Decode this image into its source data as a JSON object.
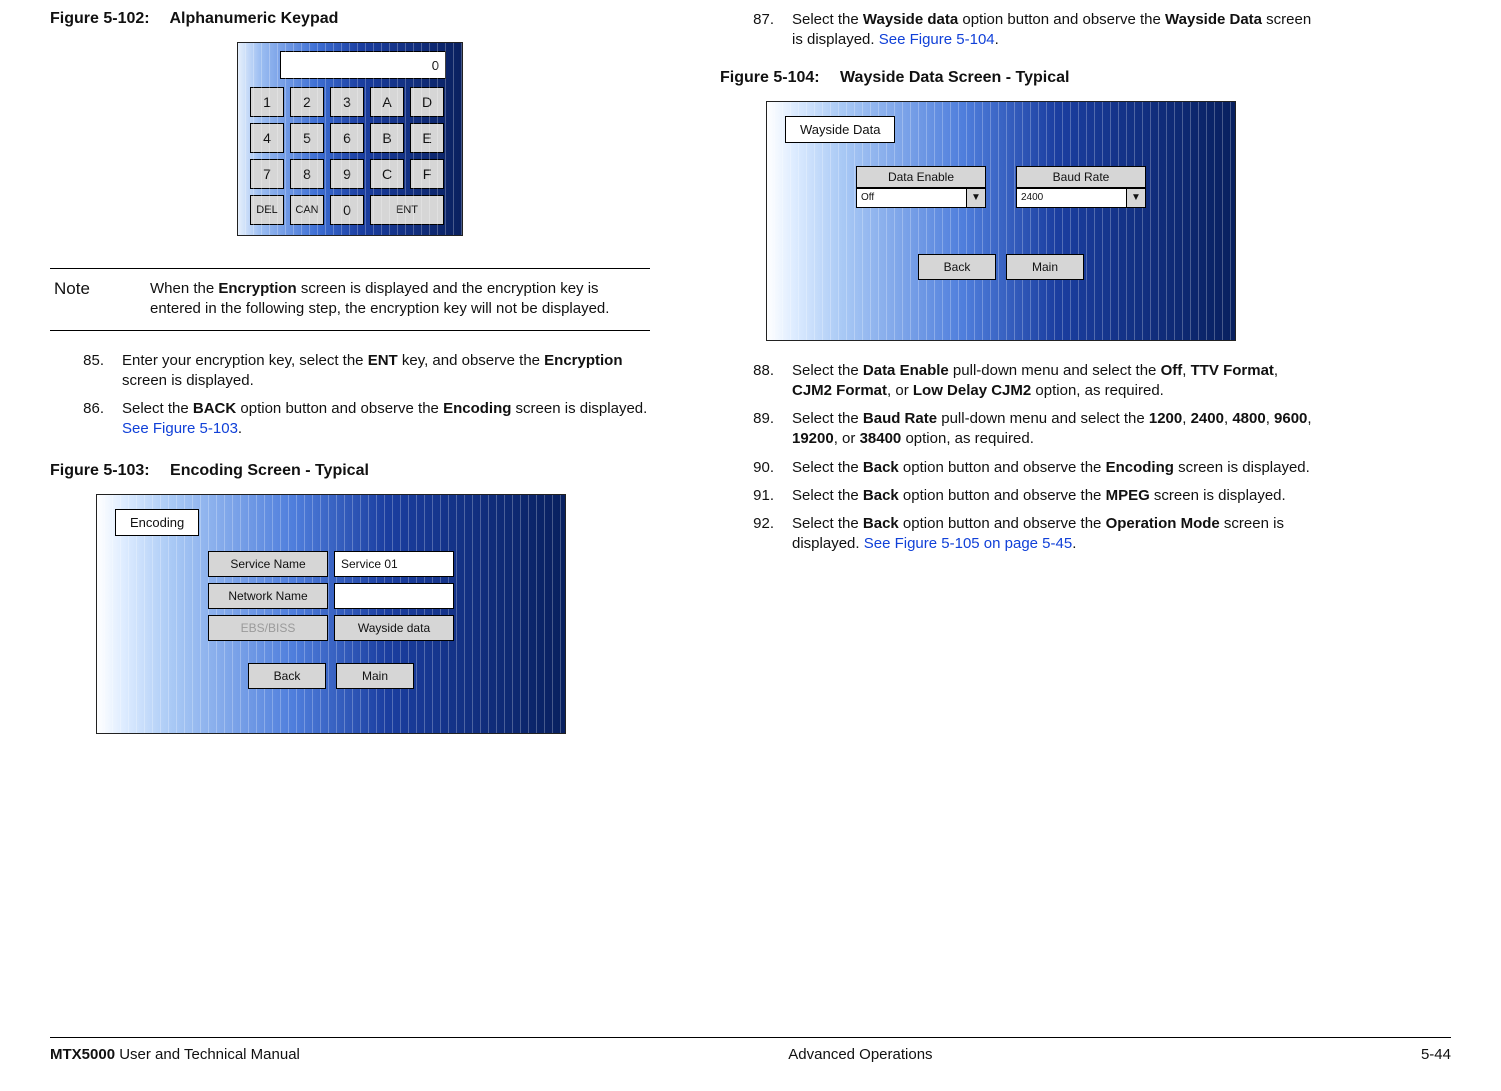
{
  "fig102": {
    "label": "Figure 5-102:",
    "title": "Alphanumeric Keypad"
  },
  "keypad": {
    "display": "0",
    "rows": [
      [
        "1",
        "2",
        "3",
        "A",
        "D"
      ],
      [
        "4",
        "5",
        "6",
        "B",
        "E"
      ],
      [
        "7",
        "8",
        "9",
        "C",
        "F"
      ]
    ],
    "bottom": {
      "del": "DEL",
      "can": "CAN",
      "zero": "0",
      "ent": "ENT"
    }
  },
  "note": {
    "label": "Note",
    "text_pre": "When the ",
    "bold1": "Encryption",
    "text_mid": " screen is displayed and the encryption key is entered in the following step, the encryption key will not be displayed."
  },
  "steps_left": {
    "s85": {
      "num": "85.",
      "pre": "Enter your encryption key, select the ",
      "b1": "ENT",
      "mid": " key, and observe the ",
      "b2": "Encryption",
      "post": " screen is displayed."
    },
    "s86": {
      "num": "86.",
      "pre": "Select the ",
      "b1": "BACK",
      "mid": " option button and observe the ",
      "b2": "Encoding",
      "post": " screen is displayed.  ",
      "link": "See Figure 5-103",
      "post2": "."
    }
  },
  "fig103": {
    "label": "Figure 5-103:",
    "title": "Encoding Screen - Typical"
  },
  "encoding": {
    "tab": "Encoding",
    "service_name_label": "Service Name",
    "service_name_value": "Service 01",
    "network_name_label": "Network Name",
    "network_name_value": "",
    "ebs": "EBS/BISS",
    "wayside": "Wayside data",
    "back": "Back",
    "main": "Main"
  },
  "steps_right": {
    "s87": {
      "num": "87.",
      "pre": "Select the ",
      "b1": "Wayside data",
      "mid": " option button and observe the ",
      "b2": "Wayside Data",
      "post": " screen is displayed.  ",
      "link": "See Figure 5-104",
      "post2": "."
    }
  },
  "fig104": {
    "label": "Figure 5-104:",
    "title": "Wayside Data Screen - Typical"
  },
  "wayside": {
    "tab": "Wayside Data",
    "data_enable_label": "Data Enable",
    "data_enable_value": "Off",
    "baud_rate_label": "Baud Rate",
    "baud_rate_value": "2400",
    "back": "Back",
    "main": "Main"
  },
  "steps_right2": {
    "s88": {
      "num": "88.",
      "pre": "Select the ",
      "b1": "Data Enable",
      "mid": " pull-down menu and select the ",
      "b2": "Off",
      "c1": ", ",
      "b3": "TTV Format",
      "c2": ", ",
      "b4": "CJM2 Format",
      "c3": ", or ",
      "b5": "Low Delay CJM2",
      "post": " option, as required."
    },
    "s89": {
      "num": "89.",
      "pre": "Select the ",
      "b1": "Baud Rate",
      "mid": " pull-down menu and select the ",
      "b2": "1200",
      "c1": ", ",
      "b3": "2400",
      "c2": ", ",
      "b4": "4800",
      "c3": ", ",
      "b5": "9600",
      "c4": ", ",
      "b6": "19200",
      "c5": ", or ",
      "b7": "38400",
      "post": " option, as required."
    },
    "s90": {
      "num": "90.",
      "pre": "Select the ",
      "b1": "Back",
      "mid": " option button and observe the ",
      "b2": "Encoding",
      "post": " screen is displayed."
    },
    "s91": {
      "num": "91.",
      "pre": "Select the ",
      "b1": "Back",
      "mid": " option button and observe the ",
      "b2": "MPEG",
      "post": " screen is displayed."
    },
    "s92": {
      "num": "92.",
      "pre": "Select the ",
      "b1": "Back",
      "mid": " option button and observe the ",
      "b2": "Operation Mode",
      "post": " screen is displayed.  ",
      "link": "See Figure 5-105 on page 5-45",
      "post2": "."
    }
  },
  "footer": {
    "left_bold": "MTX5000",
    "left_rest": " User and Technical Manual",
    "center": "Advanced Operations",
    "right": "5-44"
  }
}
